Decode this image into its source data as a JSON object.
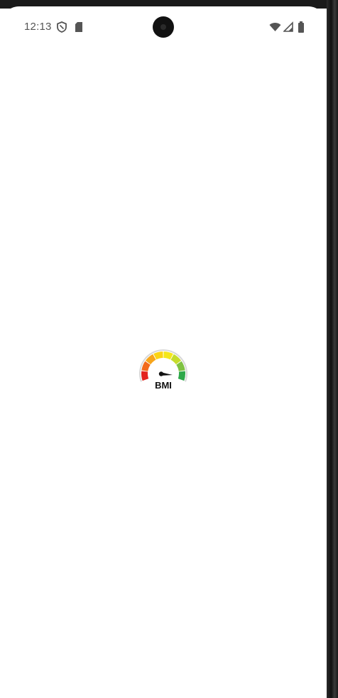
{
  "status_bar": {
    "time": "12:13",
    "left_icons": [
      "shield-icon",
      "sd-card-icon"
    ],
    "right_icons": [
      "wifi-icon",
      "cell-signal-icon",
      "battery-icon"
    ]
  },
  "splash": {
    "logo_text": "BMI",
    "logo_icon": "bmi-gauge-icon",
    "gauge_colors": [
      "#e3231e",
      "#f26a1b",
      "#f7a51b",
      "#fbd414",
      "#f4e71a",
      "#c6dc2b",
      "#7fc242",
      "#2ea84a"
    ]
  }
}
